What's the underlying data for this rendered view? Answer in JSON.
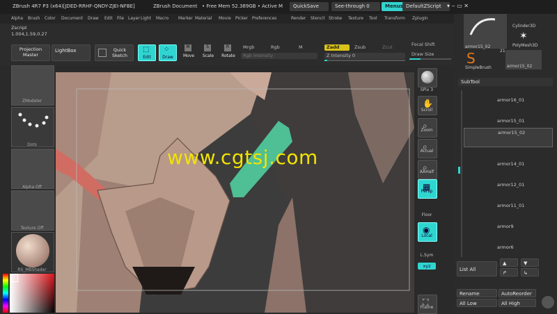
{
  "titlebar": {
    "app_version": "ZBrush 4R7 P3 (x64)[JDED-RRHF-QNDY-ZJEI-NFBE]",
    "document": "ZBrush Document",
    "free_mem": "• Free Mem 52.389GB • Active M",
    "quicksave": "QuickSave",
    "see_through": "See-through  0",
    "menus": "Menus",
    "default_script": "DefaultZScript"
  },
  "menubar": [
    "Alpha",
    "Brush",
    "Color",
    "Document",
    "Draw",
    "Edit",
    "File",
    "Layer",
    "Light",
    "Macro",
    "Marker",
    "Material",
    "Movie",
    "Picker",
    "Preferences",
    "Render",
    "Stencil",
    "Stroke",
    "Texture",
    "Tool",
    "Transform",
    "Zplugin"
  ],
  "toolbar": {
    "zscript": "Zscript",
    "coords": "1.004,1.59,0.27",
    "projection_master": "Projection Master",
    "lightbox": "LightBox",
    "quick_sketch": "Quick Sketch",
    "edit": "Edit",
    "draw": "Draw",
    "move": "Move",
    "scale": "Scale",
    "rotate": "Rotate",
    "mrgb": "Mrgb",
    "rgb": "Rgb",
    "m": "M",
    "rgb_intensity": "Rgb Intensity",
    "zadd": "Zadd",
    "zsub": "Zsub",
    "zcut": "Zcut",
    "z_intensity": "Z Intensity 0",
    "focal_shift": "Focal Shift",
    "draw_size": "Draw Size"
  },
  "leftpanel": {
    "brush_label": "ZModeler",
    "stroke_label": "Dots",
    "alpha_label": "Alpha Off",
    "texture_label": "Texture Off",
    "material_label": "RS_MBShader"
  },
  "canvas": {
    "watermark": "www.cgtsj.com"
  },
  "rightcol": {
    "bpr": "BPR",
    "spix": "SPix 3",
    "scroll": "Scroll",
    "zoom": "Zoom",
    "actual": "Actual",
    "aahalf": "AAHalf",
    "persp": "Persp",
    "floor": "Floor",
    "local": "Local",
    "lsym": "L.Sym",
    "xyz": "xyz",
    "frame": "Frame"
  },
  "tray": {
    "top_items": [
      {
        "label": "armor15_02"
      },
      {
        "label": "Cylinder3D"
      },
      {
        "label": "PolyMesh3D"
      },
      {
        "label": "SimpleBrush"
      },
      {
        "label": "armor15_02"
      }
    ],
    "count": "21",
    "subtool_title": "SubTool",
    "subtools": [
      "armor16_01",
      "armor15_01",
      "armor15_02",
      "armor14_01",
      "armor12_01",
      "armor11_01",
      "armor9",
      "armor6"
    ],
    "list_all": "List All",
    "rename": "Rename",
    "autoreorder": "AutoReorder",
    "all_low": "All Low",
    "all_high": "All High"
  },
  "colors": {
    "accent": "#34d3cf",
    "highlight": "#d9c31b",
    "watermark": "#f2e400"
  }
}
